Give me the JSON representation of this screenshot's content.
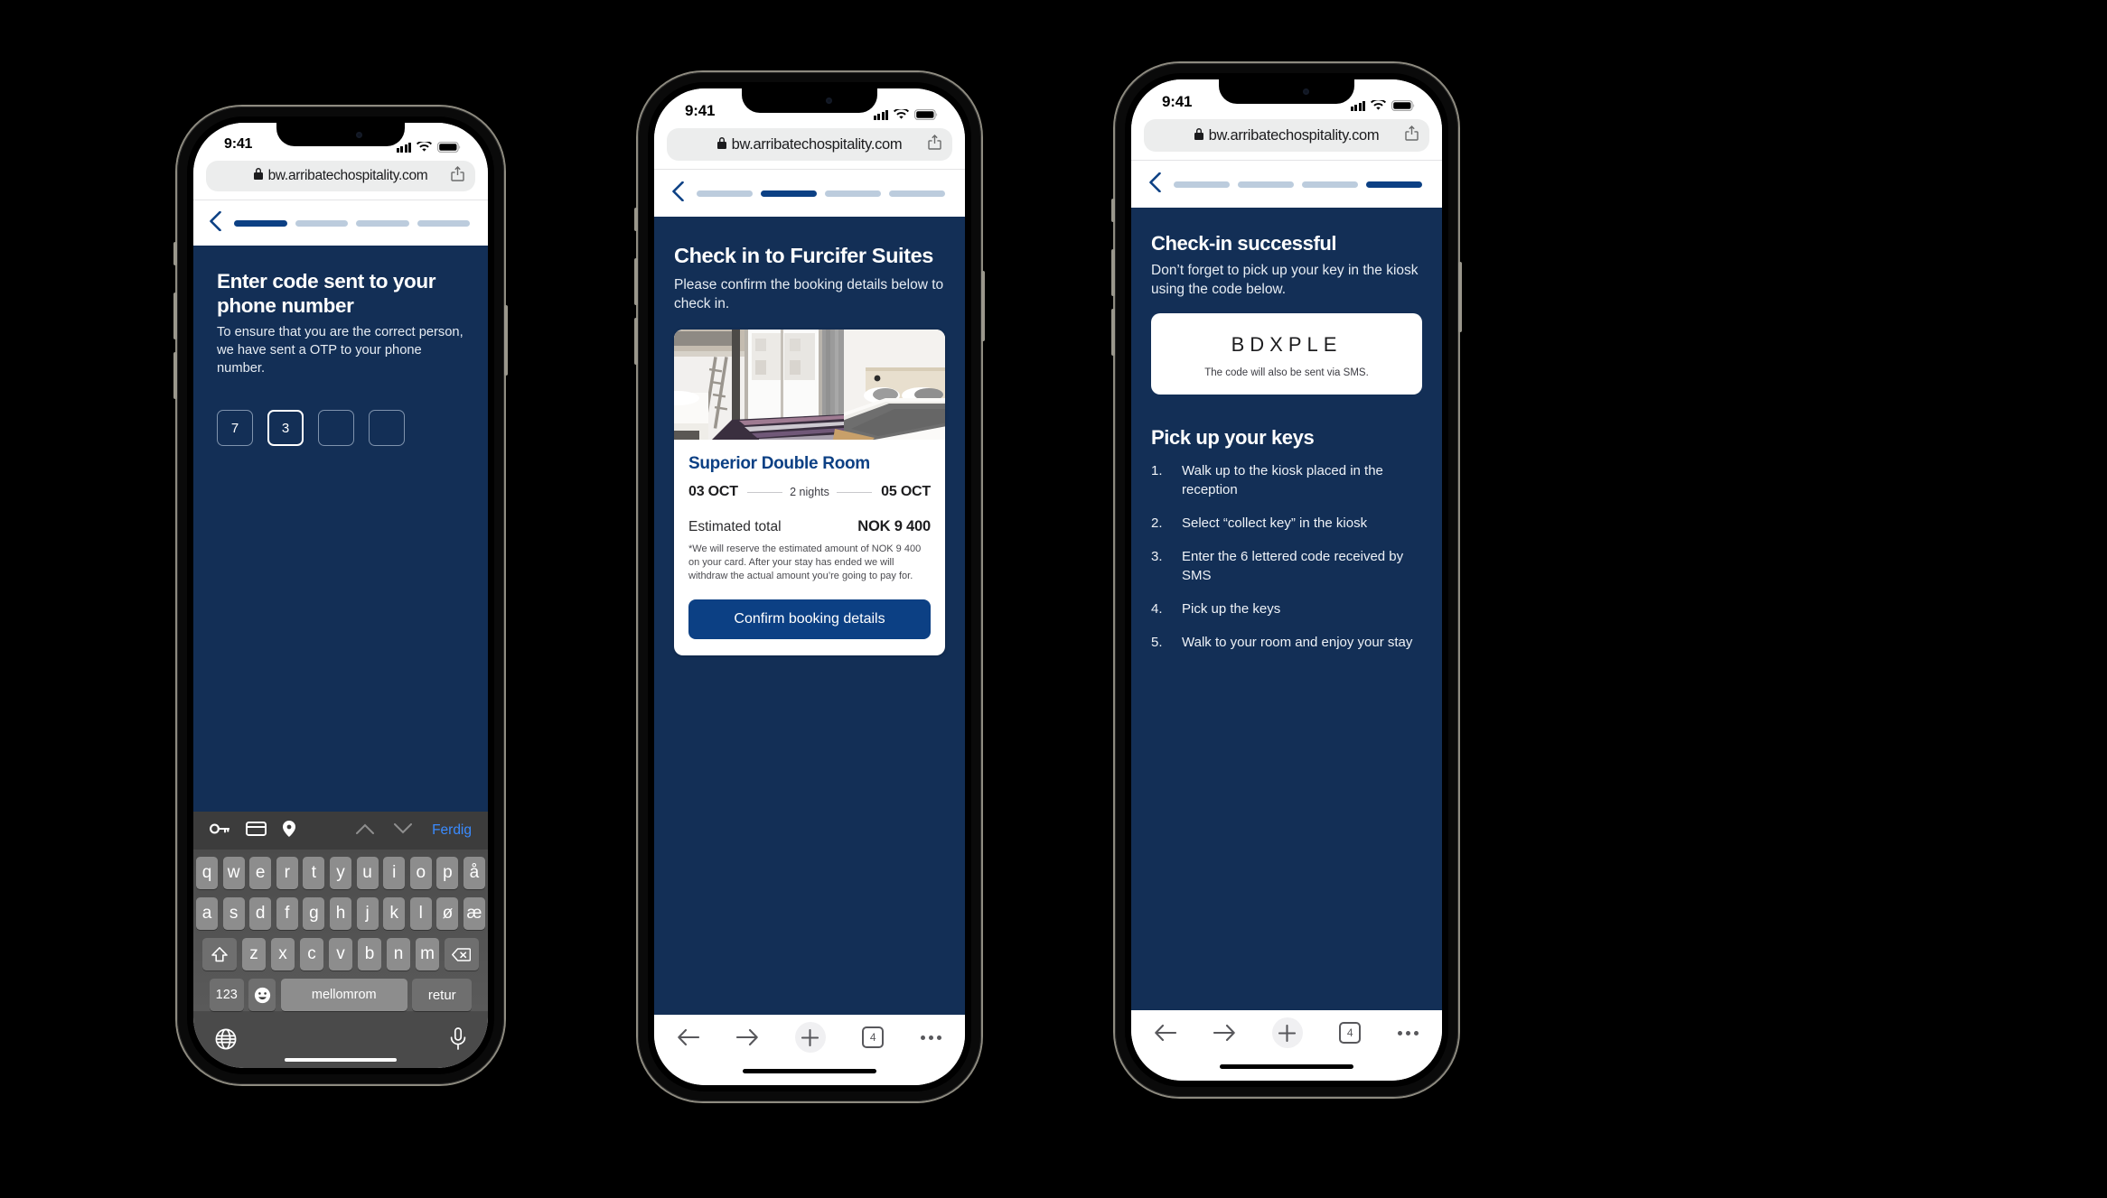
{
  "browser": {
    "url": "bw.arribatechospitality.com",
    "lock_icon": "lock-icon",
    "share_icon": "share-icon",
    "status_time": "9:41",
    "signal_icon": "cellular-signal-icon",
    "wifi_icon": "wifi-icon",
    "battery_icon": "battery-icon",
    "bottom_bar": {
      "back_icon": "arrow-left-icon",
      "forward_icon": "arrow-right-icon",
      "new_tab_icon": "plus-icon",
      "tab_count": "4",
      "more_icon": "ellipsis-icon"
    }
  },
  "screen1": {
    "back_icon": "chevron-left-icon",
    "progress": {
      "total": 4,
      "active_index": 0
    },
    "title": "Enter code sent to your phone number",
    "subtitle": "To ensure that you are the correct person, we have sent a OTP to your phone number.",
    "otp": {
      "digits": [
        "7",
        "3",
        "",
        ""
      ],
      "focused_index": 1
    },
    "keyboard": {
      "accessory": {
        "password_icon": "key-icon",
        "card_icon": "credit-card-icon",
        "location_icon": "map-pin-icon",
        "up_icon": "chevron-up-icon",
        "down_icon": "chevron-down-icon",
        "done_label": "Ferdig"
      },
      "row1": [
        "q",
        "w",
        "e",
        "r",
        "t",
        "y",
        "u",
        "i",
        "o",
        "p",
        "å"
      ],
      "row2": [
        "a",
        "s",
        "d",
        "f",
        "g",
        "h",
        "j",
        "k",
        "l",
        "ø",
        "æ"
      ],
      "row3": [
        "z",
        "x",
        "c",
        "v",
        "b",
        "n",
        "m"
      ],
      "shift_icon": "shift-icon",
      "backspace_icon": "backspace-icon",
      "numbers_label": "123",
      "emoji_icon": "emoji-icon",
      "space_label": "mellomrom",
      "return_label": "retur",
      "globe_icon": "globe-icon",
      "mic_icon": "microphone-icon"
    }
  },
  "screen2": {
    "back_icon": "chevron-left-icon",
    "progress": {
      "total": 4,
      "active_index": 1
    },
    "title": "Check in to Furcifer Suites",
    "subtitle": "Please confirm the booking details below to check in.",
    "card": {
      "photo_alt": "hotel-room-photo",
      "room_name": "Superior Double Room",
      "check_in_date": "03 OCT",
      "nights": "2 nights",
      "check_out_date": "05 OCT",
      "total_label": "Estimated total",
      "total_value": "NOK 9 400",
      "fineprint": "*We will reserve the estimated amount of NOK 9 400 on your card. After your stay has ended we will withdraw the actual amount you’re going to pay for.",
      "cta_label": "Confirm booking details"
    }
  },
  "screen3": {
    "back_icon": "chevron-left-icon",
    "progress": {
      "total": 4,
      "active_index": 3
    },
    "title": "Check-in successful",
    "subtitle": "Don’t forget to pick up your key in the kiosk using the code below.",
    "code_card": {
      "code": "BDXPLE",
      "note": "The code will also be sent via SMS."
    },
    "keys_heading": "Pick up your keys",
    "steps": [
      {
        "num": "1.",
        "text": "Walk up to the kiosk placed in the reception"
      },
      {
        "num": "2.",
        "text": "Select “collect key” in the kiosk"
      },
      {
        "num": "3.",
        "text": "Enter the 6 lettered code received by SMS"
      },
      {
        "num": "4.",
        "text": "Pick up the keys"
      },
      {
        "num": "5.",
        "text": "Walk to your room and enjoy your stay"
      }
    ]
  },
  "colors": {
    "navy": "#132f56",
    "accent_blue": "#0c4084",
    "progress_inactive": "#bcccdd",
    "page_background": "#000000"
  }
}
